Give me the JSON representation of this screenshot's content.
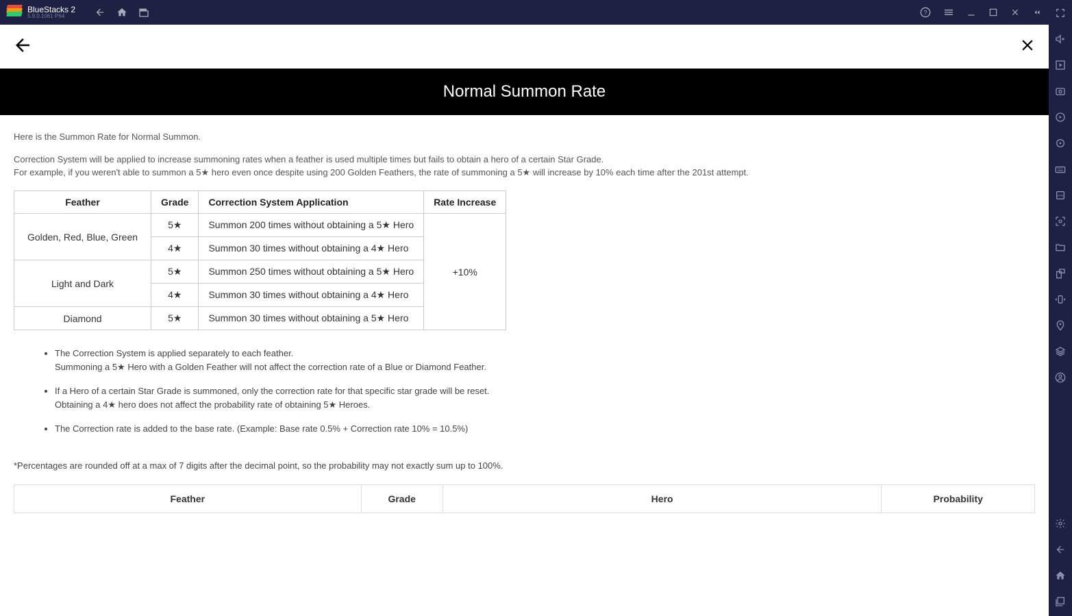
{
  "app": {
    "name": "BlueStacks 2",
    "version": "5.9.0.1061  P64"
  },
  "page": {
    "title": "Normal Summon Rate",
    "intro1": "Here is the Summon Rate for Normal Summon.",
    "intro2": "Correction System will be applied to increase summoning rates when a feather is used multiple times but fails to obtain a hero of a certain Star Grade.",
    "intro3": "For example, if you weren't able to summon a 5★ hero even once despite using 200 Golden Feathers, the rate of summoning a 5★ will increase by 10% each time after the 201st attempt."
  },
  "correction_table": {
    "headers": {
      "feather": "Feather",
      "grade": "Grade",
      "application": "Correction System Application",
      "rate": "Rate Increase"
    },
    "rate_value": "+10%",
    "rows": [
      {
        "feather": "Golden, Red, Blue, Green",
        "grade": "5★",
        "app": "Summon 200 times without obtaining a 5★ Hero"
      },
      {
        "feather": "",
        "grade": "4★",
        "app": "Summon 30 times without obtaining a 4★ Hero"
      },
      {
        "feather": "Light and Dark",
        "grade": "5★",
        "app": "Summon 250 times without obtaining a 5★ Hero"
      },
      {
        "feather": "",
        "grade": "4★",
        "app": "Summon 30 times without obtaining a 4★ Hero"
      },
      {
        "feather": "Diamond",
        "grade": "5★",
        "app": "Summon 30 times without obtaining a 5★ Hero"
      }
    ]
  },
  "bullets": {
    "b1a": "The Correction System is applied separately to each feather.",
    "b1b": "Summoning a 5★ Hero with a Golden Feather will not affect the correction rate of a Blue or Diamond Feather.",
    "b2a": "If a Hero of a certain Star Grade is summoned, only the correction rate for that specific star grade will be reset.",
    "b2b": "Obtaining a 4★ hero does not affect the probability rate of obtaining 5★ Heroes.",
    "b3": "The Correction rate is added to the base rate. (Example: Base rate 0.5% + Correction rate 10% = 10.5%)"
  },
  "footnote": "*Percentages are rounded off at a max of 7 digits after the decimal point, so the probability may not exactly sum up to 100%.",
  "rate_table": {
    "headers": {
      "feather": "Feather",
      "grade": "Grade",
      "hero": "Hero",
      "probability": "Probability"
    }
  }
}
